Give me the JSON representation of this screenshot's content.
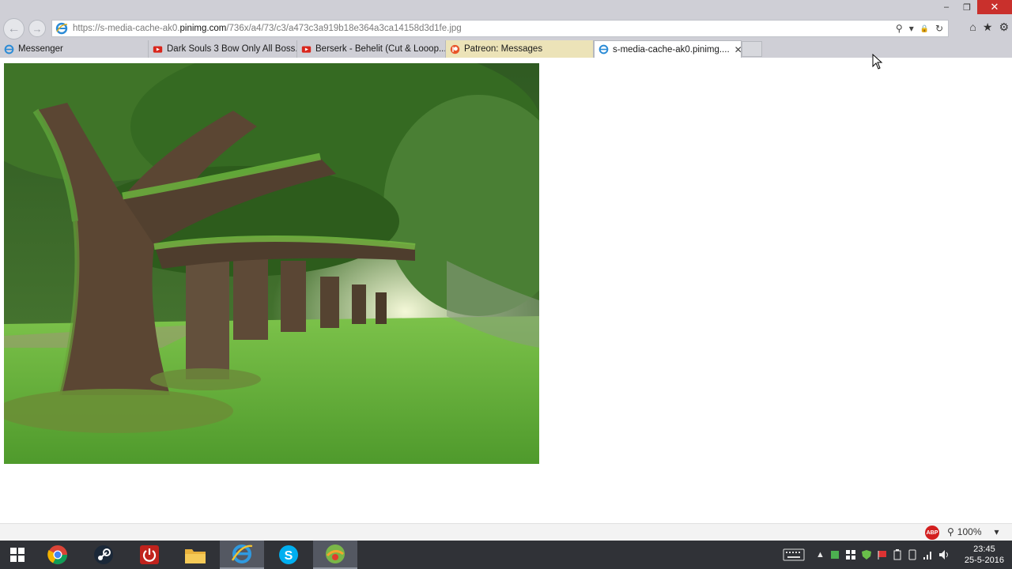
{
  "browser": {
    "url_prefix": "https://s-media-cache-ak0.",
    "url_domain": "pinimg.com",
    "url_path": "/736x/a4/73/c3/a473c3a919b18e364a3ca14158d3d1fe.jpg",
    "window_controls": {
      "minimize": "–",
      "maximize": "❐",
      "close": "✕"
    },
    "address_tools": {
      "search": "⚲",
      "dropdown": "▾",
      "lock": "🔒",
      "refresh": "↻"
    },
    "right_icons": {
      "home": "⌂",
      "favorites": "★",
      "settings": "⚙"
    },
    "nav": {
      "back": "←",
      "forward": "→"
    }
  },
  "tabs": [
    {
      "label": "Messenger",
      "icon": "ie-icon",
      "state": "inactive"
    },
    {
      "label": "Dark Souls 3 Bow Only All Boss...",
      "icon": "youtube-icon",
      "state": "inactive"
    },
    {
      "label": "Berserk - Behelit (Cut & Looop...",
      "icon": "youtube-icon",
      "state": "inactive"
    },
    {
      "label": "Patreon: Messages",
      "icon": "patreon-icon",
      "state": "highlighted"
    },
    {
      "label": "s-media-cache-ak0.pinimg....",
      "icon": "ie-icon",
      "state": "active",
      "close": "✕"
    }
  ],
  "content": {
    "image_description_icon": "oak-tree-alley-photo"
  },
  "statusbar": {
    "adblock_label": "ABP",
    "zoom": "100%",
    "zoom_dropdown": "▾"
  },
  "taskbar": {
    "items": [
      "start-icon",
      "chrome-icon",
      "steam-icon",
      "power-app-icon",
      "file-explorer-icon",
      "internet-explorer-icon",
      "skype-icon",
      "app-icon"
    ],
    "time": "23:45",
    "date": "25-5-2016"
  },
  "colors": {
    "chrome_bar": "#cfcfd6",
    "taskbar": "#303237",
    "close": "#c9302c",
    "patreon_tab": "#ece3b8"
  }
}
